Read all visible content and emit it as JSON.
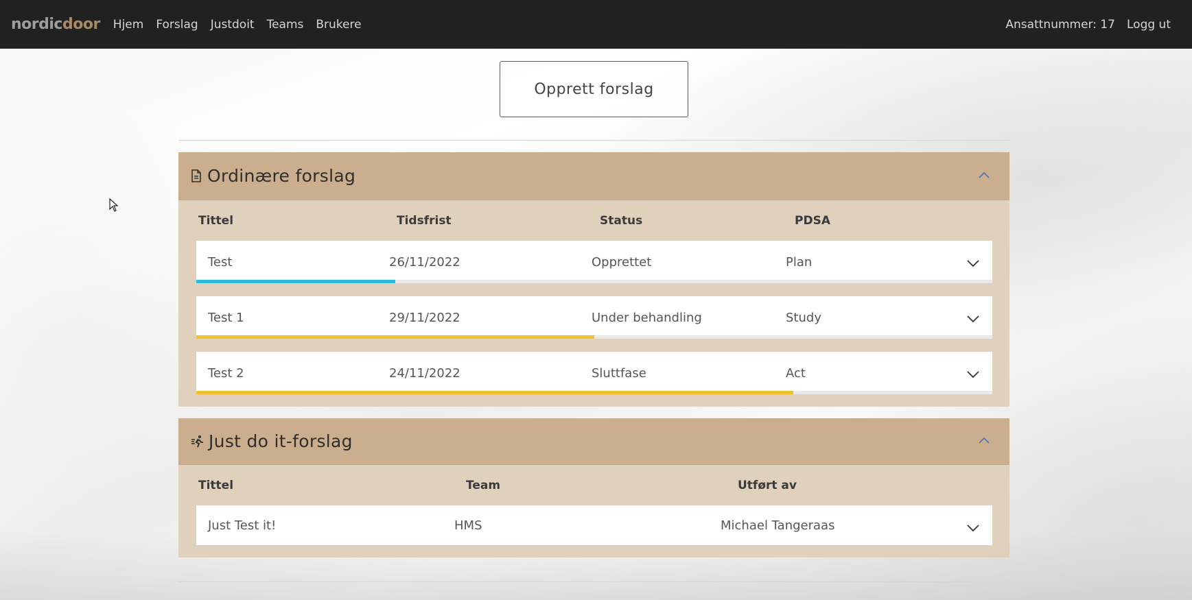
{
  "nav": {
    "brand_part1": "nordic",
    "brand_part2": "door",
    "links": [
      "Hjem",
      "Forslag",
      "Justdoit",
      "Teams",
      "Brukere"
    ],
    "employee_label": "Ansattnummer: 17",
    "logout_label": "Logg ut"
  },
  "create_button_label": "Opprett forslag",
  "ordinary": {
    "title": "Ordinære forslag",
    "icon": "document-icon",
    "columns": [
      "Tittel",
      "Tidsfrist",
      "Status",
      "PDSA"
    ],
    "rows": [
      {
        "title": "Test",
        "deadline": "26/11/2022",
        "status": "Opprettet",
        "pdsa": "Plan",
        "progress": 0.25,
        "color": "#2bbde0"
      },
      {
        "title": "Test 1",
        "deadline": "29/11/2022",
        "status": "Under behandling",
        "pdsa": "Study",
        "progress": 0.5,
        "color": "#f2c12e"
      },
      {
        "title": "Test 2",
        "deadline": "24/11/2022",
        "status": "Sluttfase",
        "pdsa": "Act",
        "progress": 0.75,
        "color": "#f2c12e"
      }
    ]
  },
  "justdoit": {
    "title": "Just do it-forslag",
    "icon": "running-person-icon",
    "columns": [
      "Tittel",
      "Team",
      "Utført av"
    ],
    "rows": [
      {
        "title": "Just Test it!",
        "team": "HMS",
        "performed_by": "Michael Tangeraas"
      }
    ]
  },
  "colors": {
    "navbar": "#212121",
    "panel_header": "#cbae8d",
    "panel_body": "#e0d1bc",
    "brand_accent": "#a88a63",
    "chevron_up": "#4a78b8"
  }
}
